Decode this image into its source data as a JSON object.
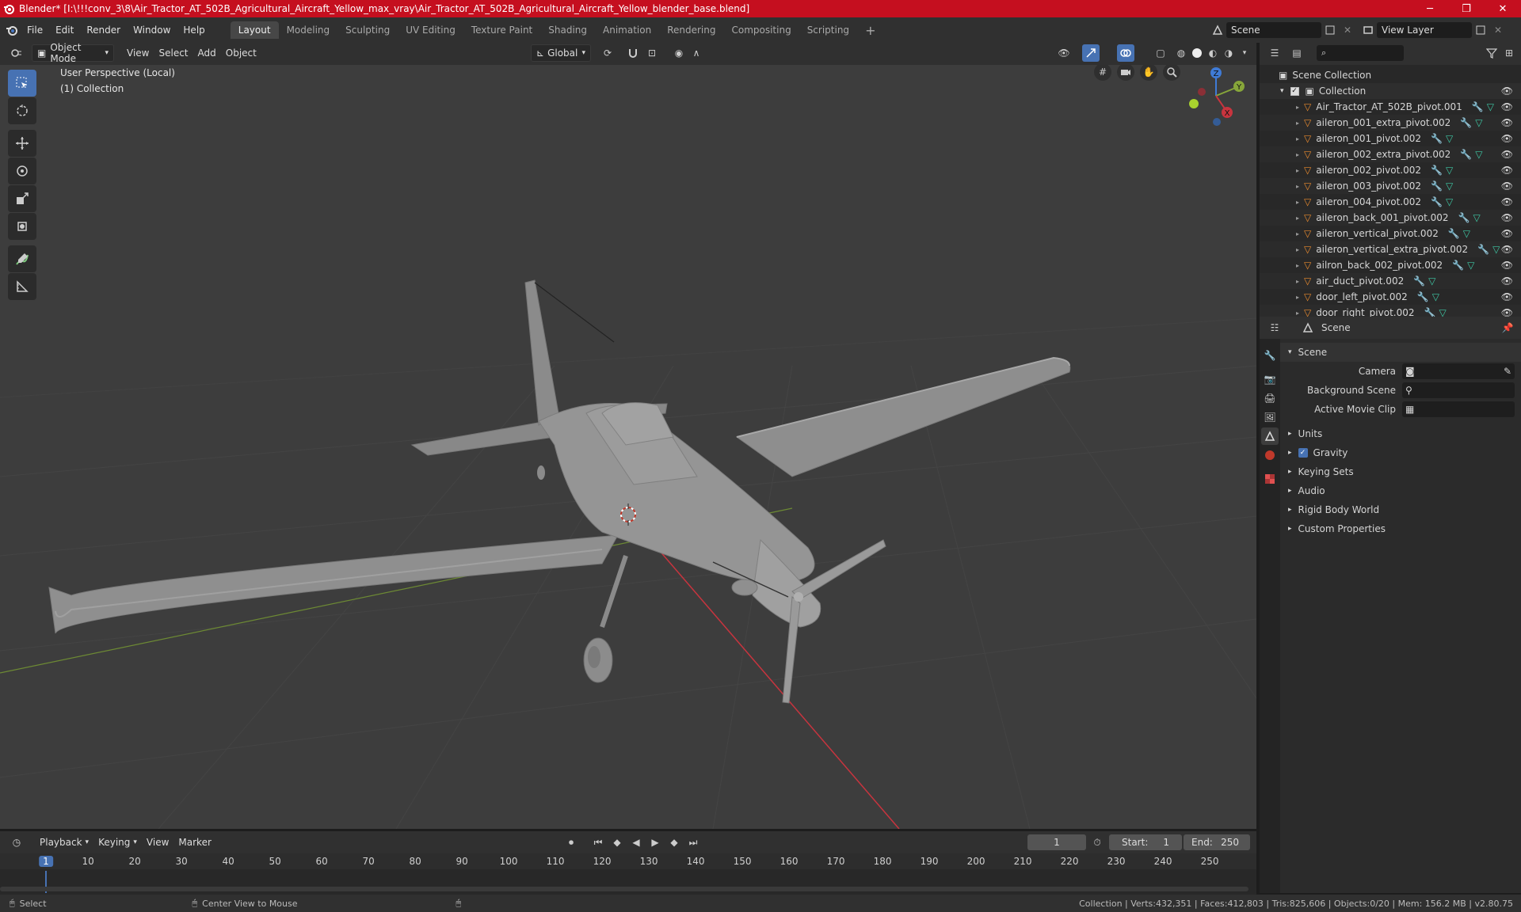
{
  "titlebar": {
    "title": "Blender* [I:\\!!!conv_3\\8\\Air_Tractor_AT_502B_Agricultural_Aircraft_Yellow_max_vray\\Air_Tractor_AT_502B_Agricultural_Aircraft_Yellow_blender_base.blend]",
    "minimize": "─",
    "restore": "❐",
    "close": "✕"
  },
  "menubar": {
    "menus": [
      "File",
      "Edit",
      "Render",
      "Window",
      "Help"
    ],
    "workspaces": [
      "Layout",
      "Modeling",
      "Sculpting",
      "UV Editing",
      "Texture Paint",
      "Shading",
      "Animation",
      "Rendering",
      "Compositing",
      "Scripting"
    ],
    "active_workspace": "Layout",
    "add_workspace": "+",
    "scene": "Scene",
    "view_layer": "View Layer"
  },
  "viewport_header": {
    "mode": "Object Mode",
    "menus": [
      "View",
      "Select",
      "Add",
      "Object"
    ],
    "transform_orientation": "Global"
  },
  "viewport": {
    "perspective_label": "User Perspective (Local)",
    "collection_label": "(1) Collection",
    "gizmo": {
      "x": "X",
      "y": "Y",
      "z": "Z"
    }
  },
  "outliner": {
    "search_placeholder": "",
    "root": "Scene Collection",
    "collection": "Collection",
    "items": [
      "Air_Tractor_AT_502B_pivot.001",
      "aileron_001_extra_pivot.002",
      "aileron_001_pivot.002",
      "aileron_002_extra_pivot.002",
      "aileron_002_pivot.002",
      "aileron_003_pivot.002",
      "aileron_004_pivot.002",
      "aileron_back_001_pivot.002",
      "aileron_vertical_pivot.002",
      "aileron_vertical_extra_pivot.002",
      "ailron_back_002_pivot.002",
      "air_duct_pivot.002",
      "door_left_pivot.002",
      "door_right_pivot.002"
    ]
  },
  "properties": {
    "context": "Scene",
    "panel": "Scene",
    "camera_label": "Camera",
    "background_scene_label": "Background Scene",
    "active_movie_clip_label": "Active Movie Clip",
    "subpanels": [
      "Units",
      "Gravity",
      "Keying Sets",
      "Audio",
      "Rigid Body World",
      "Custom Properties"
    ],
    "gravity_checked": true
  },
  "timeline": {
    "menus": [
      "Playback",
      "Keying",
      "View",
      "Marker"
    ],
    "current_frame": "1",
    "start_label": "Start:",
    "start": "1",
    "end_label": "End:",
    "end": "250",
    "ruler": [
      "1",
      "10",
      "20",
      "30",
      "40",
      "50",
      "60",
      "70",
      "80",
      "90",
      "100",
      "110",
      "120",
      "130",
      "140",
      "150",
      "160",
      "170",
      "180",
      "190",
      "200",
      "210",
      "220",
      "230",
      "240",
      "250"
    ]
  },
  "statusbar": {
    "select": "Select",
    "center_view": "Center View to Mouse",
    "stats": "Collection | Verts:432,351 | Faces:412,803 | Tris:825,606 | Objects:0/20 | Mem: 156.2 MB | v2.80.75"
  },
  "colors": {
    "titlebar": "#c50f1f",
    "accent": "#4772b3",
    "viewport_bg": "#3d3d3d",
    "x_axis": "#c8343e",
    "y_axis": "#87a63a",
    "z_axis": "#3f7bd6",
    "mesh_icon": "#e88a2e",
    "modifier_icon": "#6ea5e6",
    "data_icon": "#3ec8a5"
  }
}
